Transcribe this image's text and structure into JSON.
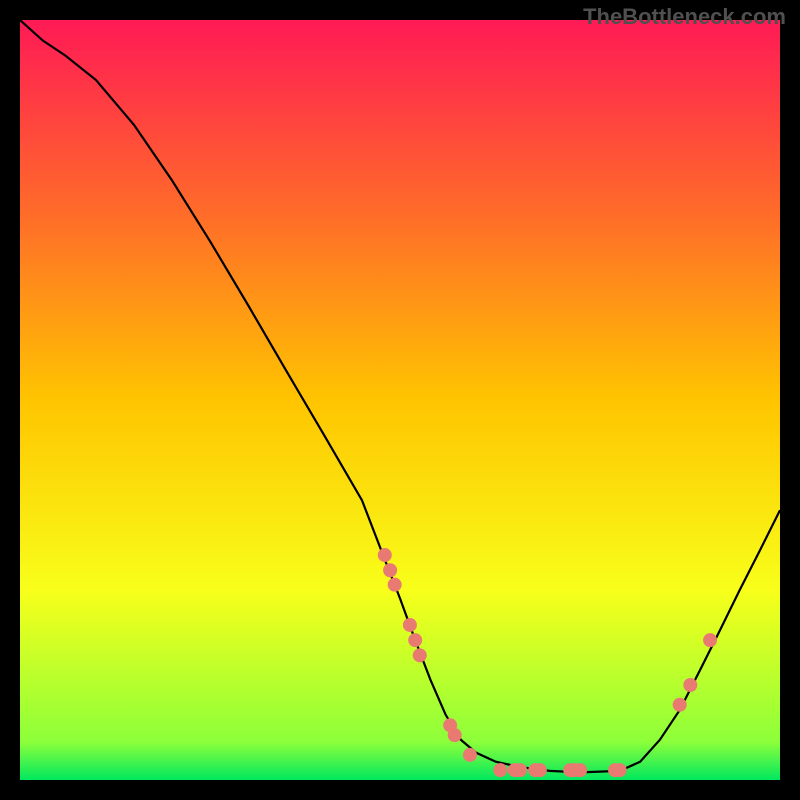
{
  "watermark": "TheBottleneck.com",
  "chart_data": {
    "type": "line",
    "title": "",
    "xlabel": "",
    "ylabel": "",
    "xlim": [
      0,
      100
    ],
    "ylim": [
      0,
      100
    ],
    "gradient_stops": [
      {
        "offset": 0,
        "color": "#ff1a55"
      },
      {
        "offset": 25,
        "color": "#ff6a2a"
      },
      {
        "offset": 50,
        "color": "#ffc400"
      },
      {
        "offset": 75,
        "color": "#f8ff1a"
      },
      {
        "offset": 95,
        "color": "#8cff3a"
      },
      {
        "offset": 100,
        "color": "#00e85e"
      }
    ],
    "curve": [
      {
        "x": 0.0,
        "y": 100.0
      },
      {
        "x": 3.0,
        "y": 97.3
      },
      {
        "x": 6.0,
        "y": 95.3
      },
      {
        "x": 10.0,
        "y": 92.1
      },
      {
        "x": 15.0,
        "y": 86.2
      },
      {
        "x": 20.0,
        "y": 78.9
      },
      {
        "x": 25.0,
        "y": 70.9
      },
      {
        "x": 30.0,
        "y": 62.5
      },
      {
        "x": 35.0,
        "y": 53.9
      },
      {
        "x": 40.0,
        "y": 45.4
      },
      {
        "x": 45.0,
        "y": 36.8
      },
      {
        "x": 48.0,
        "y": 29.0
      },
      {
        "x": 50.0,
        "y": 23.9
      },
      {
        "x": 52.0,
        "y": 18.4
      },
      {
        "x": 54.0,
        "y": 13.2
      },
      {
        "x": 56.0,
        "y": 8.6
      },
      {
        "x": 58.0,
        "y": 5.3
      },
      {
        "x": 60.0,
        "y": 3.6
      },
      {
        "x": 62.6,
        "y": 2.4
      },
      {
        "x": 65.8,
        "y": 1.7
      },
      {
        "x": 69.7,
        "y": 1.2
      },
      {
        "x": 73.7,
        "y": 1.0
      },
      {
        "x": 76.3,
        "y": 1.1
      },
      {
        "x": 78.9,
        "y": 1.2
      },
      {
        "x": 81.6,
        "y": 2.4
      },
      {
        "x": 84.2,
        "y": 5.3
      },
      {
        "x": 86.8,
        "y": 9.2
      },
      {
        "x": 89.5,
        "y": 14.5
      },
      {
        "x": 92.1,
        "y": 19.7
      },
      {
        "x": 94.7,
        "y": 25.0
      },
      {
        "x": 97.4,
        "y": 30.3
      },
      {
        "x": 100.0,
        "y": 35.5
      }
    ],
    "markers": [
      {
        "x": 48.0,
        "y": 29.6
      },
      {
        "x": 48.7,
        "y": 27.6
      },
      {
        "x": 49.3,
        "y": 25.7
      },
      {
        "x": 51.3,
        "y": 20.4
      },
      {
        "x": 52.0,
        "y": 18.4
      },
      {
        "x": 52.6,
        "y": 16.4
      },
      {
        "x": 56.6,
        "y": 7.2
      },
      {
        "x": 57.2,
        "y": 5.9
      },
      {
        "x": 59.2,
        "y": 3.3
      },
      {
        "x": 63.2,
        "y": 1.3
      },
      {
        "x": 65.1,
        "y": 1.3
      },
      {
        "x": 65.8,
        "y": 1.3
      },
      {
        "x": 67.8,
        "y": 1.3
      },
      {
        "x": 68.4,
        "y": 1.3
      },
      {
        "x": 72.4,
        "y": 1.3
      },
      {
        "x": 73.0,
        "y": 1.3
      },
      {
        "x": 73.7,
        "y": 1.3
      },
      {
        "x": 78.3,
        "y": 1.3
      },
      {
        "x": 78.9,
        "y": 1.3
      },
      {
        "x": 86.8,
        "y": 9.9
      },
      {
        "x": 88.2,
        "y": 12.5
      },
      {
        "x": 90.8,
        "y": 18.4
      }
    ]
  }
}
